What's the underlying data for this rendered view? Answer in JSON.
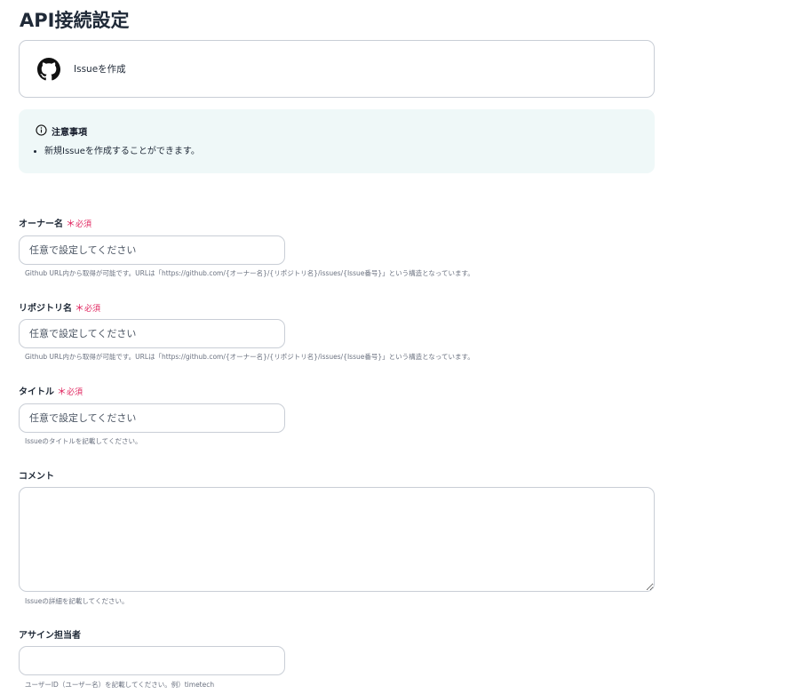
{
  "page_title": "API接続設定",
  "action": {
    "icon": "github-icon",
    "label": "Issueを作成"
  },
  "notice": {
    "icon": "info-icon",
    "title": "注意事項",
    "items": [
      "新規Issueを作成することができます。"
    ]
  },
  "required_star": "＊",
  "required_text": "必須",
  "fields": {
    "owner": {
      "label": "オーナー名",
      "placeholder": "任意で設定してください",
      "help": "Github URL内から取得が可能です。URLは「https://github.com/{オーナー名}/{リポジトリ名}/issues/{Issue番号}」という構造となっています。"
    },
    "repo": {
      "label": "リポジトリ名",
      "placeholder": "任意で設定してください",
      "help": "Github URL内から取得が可能です。URLは「https://github.com/{オーナー名}/{リポジトリ名}/issues/{Issue番号}」という構造となっています。"
    },
    "title": {
      "label": "タイトル",
      "placeholder": "任意で設定してください",
      "help": "Issueのタイトルを記載してください。"
    },
    "comment": {
      "label": "コメント",
      "placeholder": "",
      "help": "Issueの詳細を記載してください。"
    },
    "assignee": {
      "label": "アサイン担当者",
      "placeholder": "",
      "help": "ユーザーID（ユーザー名）を記載してください。例）timetech"
    }
  },
  "colors": {
    "required": "#e0245e",
    "notice_bg": "#eff8f8",
    "border": "#c9ced6"
  }
}
